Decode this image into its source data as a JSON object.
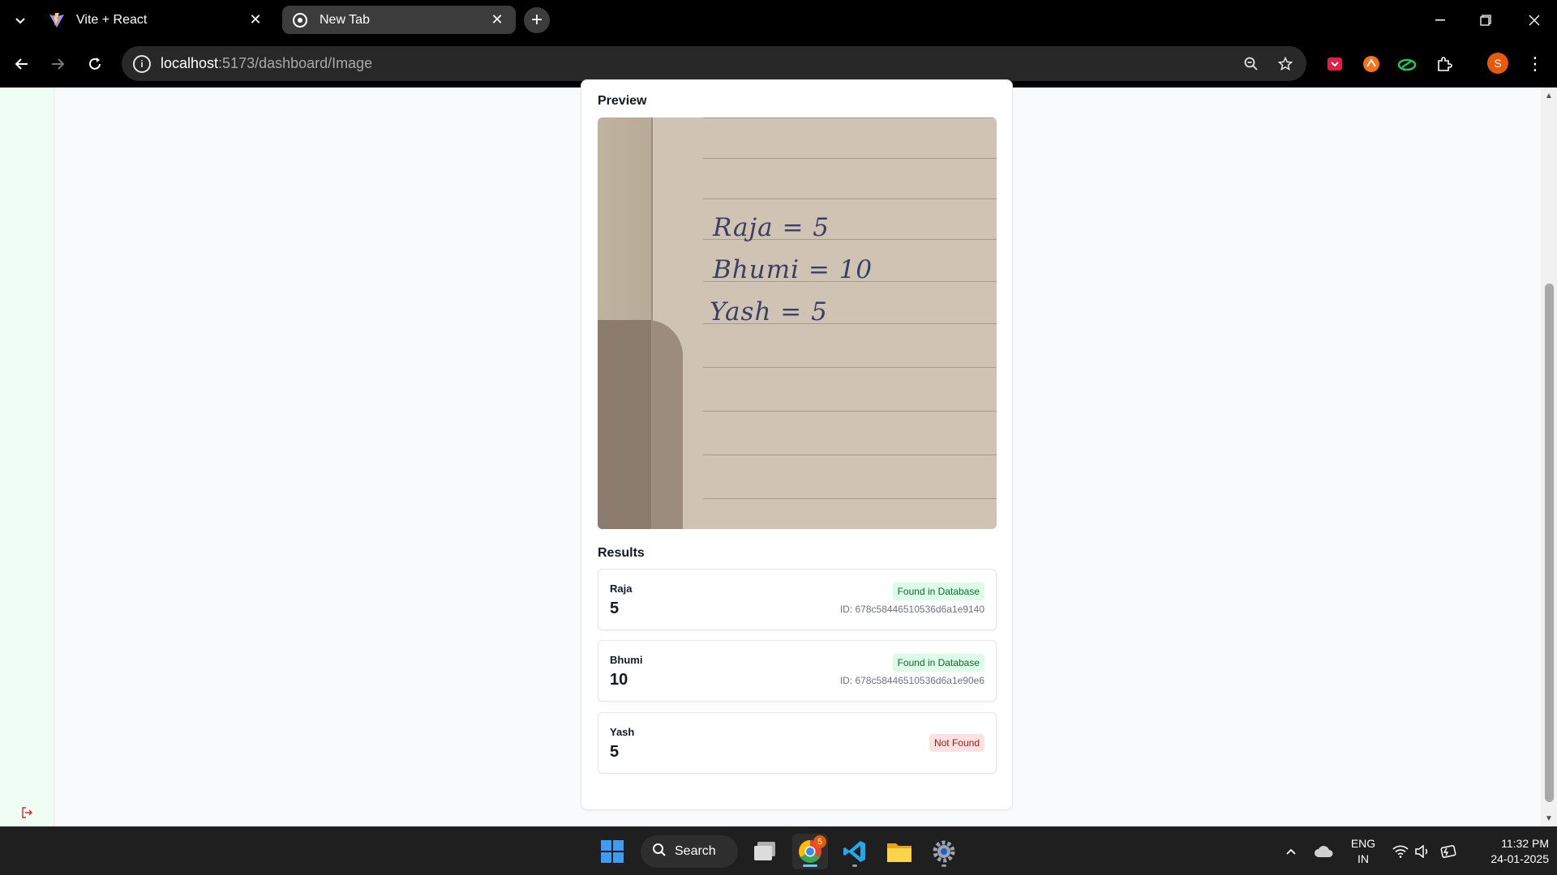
{
  "browser": {
    "tabs": [
      {
        "title": "Vite + React",
        "active": false
      },
      {
        "title": "New Tab",
        "active": true
      }
    ],
    "url_host": "localhost",
    "url_rest": ":5173/dashboard/Image",
    "profile_initial": "S",
    "colors": {
      "accent": "#e8590c",
      "chrome_bg": "#000000",
      "omnibox_bg": "#282828"
    }
  },
  "preview": {
    "label": "Preview",
    "handwriting": [
      "Raja = 5",
      "Bhumi = 10",
      "Yash = 5"
    ]
  },
  "results": {
    "label": "Results",
    "items": [
      {
        "name": "Raja",
        "value": "5",
        "status": "Found in Database",
        "found": true,
        "id": "ID: 678c58446510536d6a1e9140"
      },
      {
        "name": "Bhumi",
        "value": "10",
        "status": "Found in Database",
        "found": true,
        "id": "ID: 678c58446510536d6a1e90e6"
      },
      {
        "name": "Yash",
        "value": "5",
        "status": "Not Found",
        "found": false,
        "id": ""
      }
    ],
    "colors": {
      "found_bg": "#dcfce7",
      "found_text": "#166534",
      "notfound_bg": "#fee2e2",
      "notfound_text": "#991b1b"
    }
  },
  "taskbar": {
    "search_label": "Search",
    "lang_line1": "ENG",
    "lang_line2": "IN",
    "time": "11:32 PM",
    "date": "24-01-2025",
    "chrome_badge": "5"
  }
}
